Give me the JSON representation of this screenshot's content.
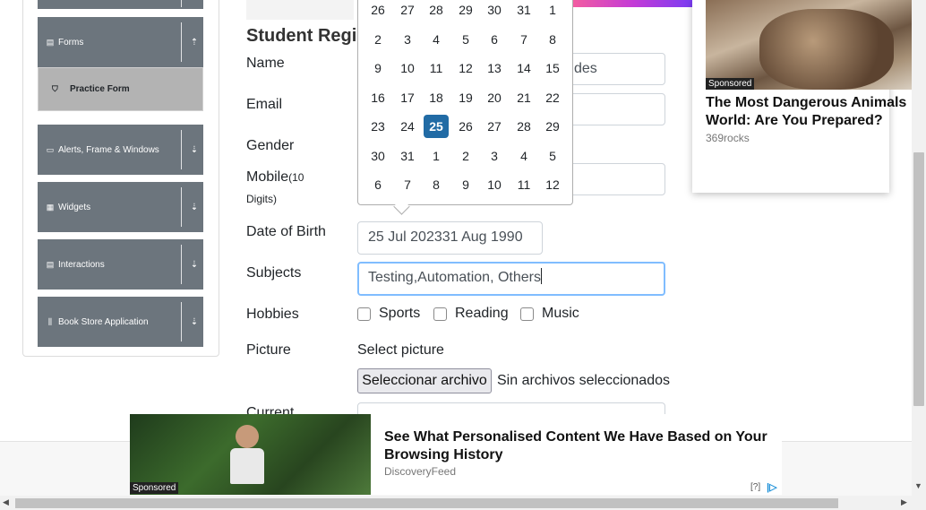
{
  "sidebar": {
    "forms": {
      "label": "Forms",
      "icon": "document-icon",
      "chevron": "chevron-up-icon"
    },
    "active_item": {
      "label": "Practice Form",
      "icon": "html5-icon"
    },
    "groups": [
      {
        "label": "Alerts, Frame & Windows",
        "icon": "window-icon"
      },
      {
        "label": "Widgets",
        "icon": "grid-icon"
      },
      {
        "label": "Interactions",
        "icon": "list-icon"
      },
      {
        "label": "Book Store Application",
        "icon": "books-icon"
      }
    ]
  },
  "form": {
    "title": "Student Regis",
    "labels": {
      "name": "Name",
      "email": "Email",
      "gender": "Gender",
      "mobile": "Mobile",
      "mobile_hint": "(10",
      "mobile_hint2": "Digits)",
      "dob": "Date of Birth",
      "subjects": "Subjects",
      "hobbies": "Hobbies",
      "picture": "Picture",
      "current": "Current"
    },
    "name_last_value": "des",
    "dob_value": "25 Jul 202331 Aug 1990",
    "subjects_value": "Testing,Automation, Others",
    "hobbies": [
      "Sports",
      "Reading",
      "Music"
    ],
    "picture_select_label": "Select picture",
    "file_button": "Seleccionar archivo",
    "file_status": "Sin archivos seleccionados"
  },
  "datepicker": {
    "weeks": [
      [
        "26",
        "27",
        "28",
        "29",
        "30",
        "31",
        "1"
      ],
      [
        "2",
        "3",
        "4",
        "5",
        "6",
        "7",
        "8"
      ],
      [
        "9",
        "10",
        "11",
        "12",
        "13",
        "14",
        "15"
      ],
      [
        "16",
        "17",
        "18",
        "19",
        "20",
        "21",
        "22"
      ],
      [
        "23",
        "24",
        "25",
        "26",
        "27",
        "28",
        "29"
      ],
      [
        "30",
        "31",
        "1",
        "2",
        "3",
        "4",
        "5"
      ],
      [
        "6",
        "7",
        "8",
        "9",
        "10",
        "11",
        "12"
      ]
    ],
    "selected": "25"
  },
  "ads": {
    "right": {
      "sponsored": "Sponsored",
      "title": "The Most Dangerous Animals World: Are You Prepared?",
      "source": "369rocks"
    },
    "bottom": {
      "sponsored": "Sponsored",
      "title": "See What Personalised Content We Have Based on Your Browsing History",
      "source": "DiscoveryFeed",
      "info": "[?]",
      "logo": "|▷"
    }
  }
}
